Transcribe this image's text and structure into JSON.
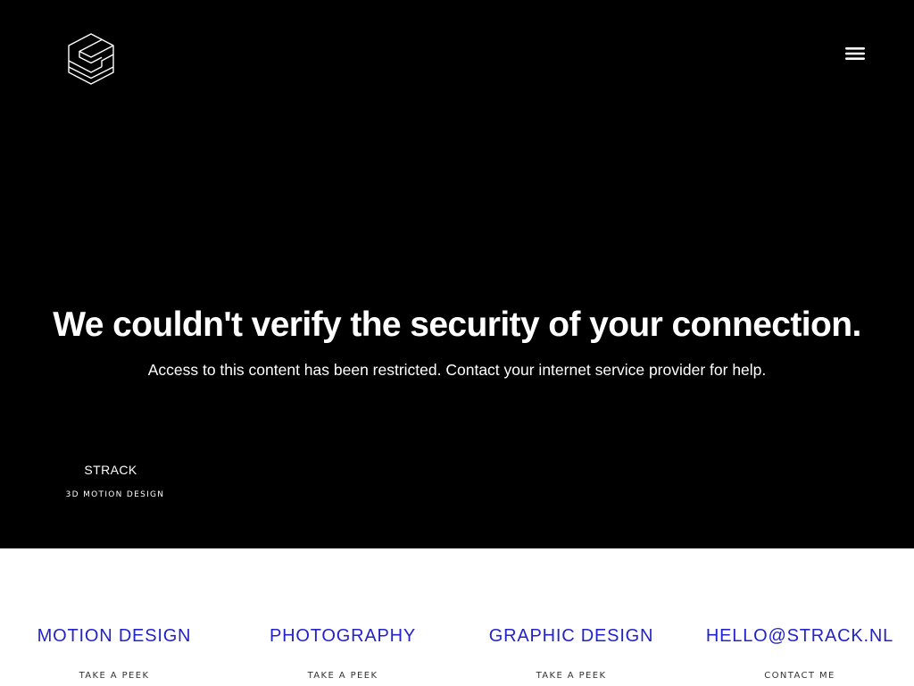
{
  "header": {
    "logo_icon": "strack-cube-logo-icon",
    "menu_icon": "hamburger-menu-icon"
  },
  "hero": {
    "headline": "We couldn't verify the security of your connection.",
    "subline": "Access to this content has been restricted. Contact your internet service provider for help."
  },
  "brand": {
    "name": "STRACK",
    "tagline": "3D MOTION DESIGN"
  },
  "services": [
    {
      "title": "MOTION DESIGN",
      "link": "TAKE A PEEK"
    },
    {
      "title": "PHOTOGRAPHY",
      "link": "TAKE A PEEK"
    },
    {
      "title": "GRAPHIC DESIGN",
      "link": "TAKE A PEEK"
    },
    {
      "title": "HELLO@STRACK.NL",
      "link": "CONTACT ME"
    }
  ],
  "colors": {
    "hero_background": "#000000",
    "hero_text": "#ffffff",
    "service_title": "#2323c8",
    "service_link": "#333333"
  }
}
